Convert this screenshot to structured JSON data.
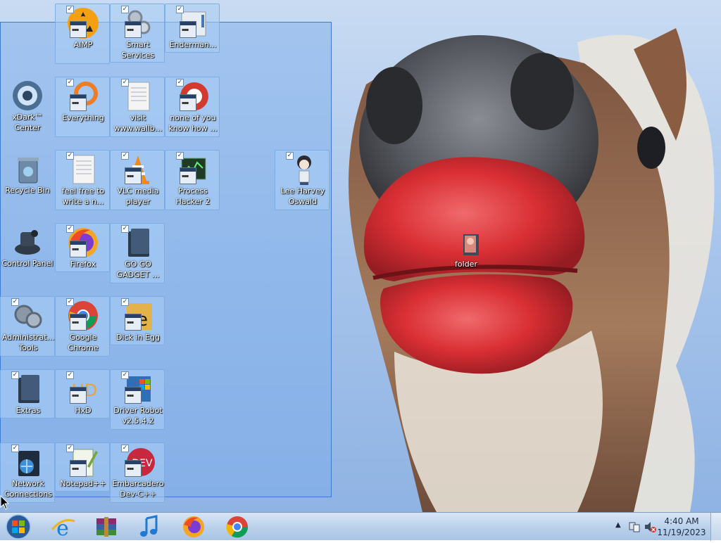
{
  "desktop": {
    "icons": [
      {
        "label": "AIMP",
        "kind": "aimp",
        "checked": true
      },
      {
        "label": "Smart Services",
        "kind": "gears",
        "checked": true
      },
      {
        "label": "Enderman...",
        "kind": "blank-app",
        "checked": true
      },
      {
        "label": "xDark™ Center",
        "kind": "xdark",
        "checked": false
      },
      {
        "label": "Everything",
        "kind": "search-orange",
        "checked": true
      },
      {
        "label": "visit www.wallb...",
        "kind": "text-doc",
        "checked": true
      },
      {
        "label": "none of you know how ...",
        "kind": "red-app",
        "checked": true
      },
      {
        "label": "Recycle Bin",
        "kind": "recycle-bin",
        "checked": false
      },
      {
        "label": "feel free to write a n...",
        "kind": "text-doc",
        "checked": true
      },
      {
        "label": "VLC media player",
        "kind": "vlc",
        "checked": true
      },
      {
        "label": "Process Hacker 2",
        "kind": "process-hacker",
        "checked": true
      },
      {
        "label": "Lee Harvey Oswald",
        "kind": "anime-figure",
        "checked": true
      },
      {
        "label": "Control Panel",
        "kind": "control-panel",
        "checked": false
      },
      {
        "label": "Firefox",
        "kind": "firefox",
        "checked": true
      },
      {
        "label": "GO GO GADGET ...",
        "kind": "dark-folder",
        "checked": true
      },
      {
        "label": "Administrat... Tools",
        "kind": "admin-tools",
        "checked": true
      },
      {
        "label": "Google Chrome",
        "kind": "chrome",
        "checked": true
      },
      {
        "label": "Dick in Egg",
        "kind": "egg-e",
        "checked": true
      },
      {
        "label": "Extras",
        "kind": "dark-folder",
        "checked": true
      },
      {
        "label": "HxD",
        "kind": "hxd",
        "checked": true
      },
      {
        "label": "Driver Robot v2.5.4.2",
        "kind": "driver-robot",
        "checked": true
      },
      {
        "label": "Network Connections",
        "kind": "network",
        "checked": true
      },
      {
        "label": "Notepad++",
        "kind": "notepadpp",
        "checked": true
      },
      {
        "label": "Embarcadero Dev-C++",
        "kind": "devcpp",
        "checked": true
      },
      {
        "label": "folder",
        "kind": "photo-folder",
        "checked": false
      }
    ]
  },
  "taskbar": {
    "start_button": "windows-start-orb",
    "pinned": [
      {
        "name": "Internet Explorer",
        "icon": "ie-icon"
      },
      {
        "name": "WinRAR",
        "icon": "archive-icon"
      },
      {
        "name": "Music",
        "icon": "music-note-icon"
      },
      {
        "name": "Firefox",
        "icon": "firefox-icon"
      },
      {
        "name": "Google Chrome",
        "icon": "chrome-icon"
      }
    ],
    "tray": {
      "time": "4:40 AM",
      "date": "11/19/2023"
    }
  }
}
